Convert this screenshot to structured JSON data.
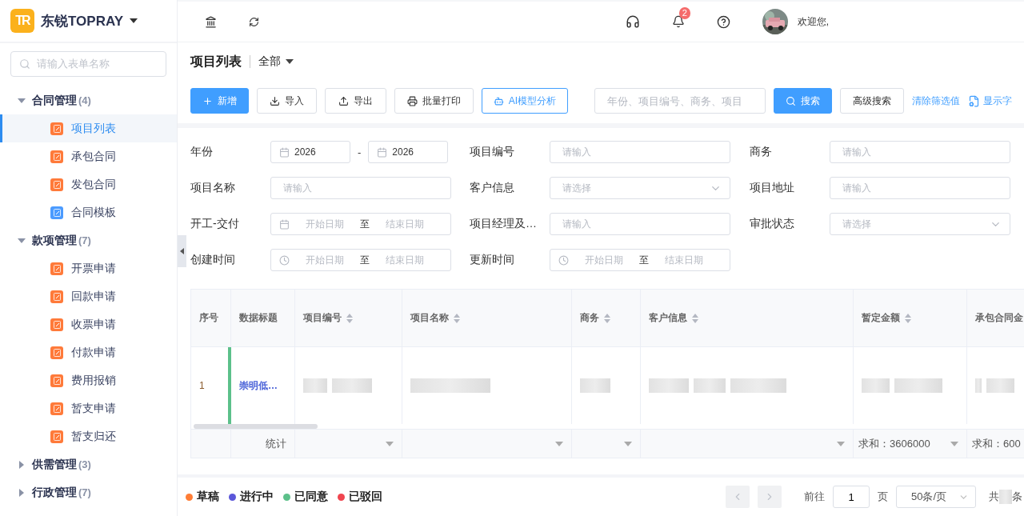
{
  "brand": {
    "name": "东锐TOPRAY",
    "logo": "TR"
  },
  "sidebar": {
    "search": {
      "placeholder": "请输入表单名称"
    },
    "groups": [
      {
        "label": "合同管理",
        "count": "(4)",
        "expanded": true,
        "children": [
          {
            "label": "项目列表",
            "selected": true,
            "color": "#ff7a3a"
          },
          {
            "label": "承包合同",
            "selected": false,
            "color": "#ff7a3a"
          },
          {
            "label": "发包合同",
            "selected": false,
            "color": "#ff7a3a"
          },
          {
            "label": "合同模板",
            "selected": false,
            "color": "#4b9bff"
          }
        ]
      },
      {
        "label": "款项管理",
        "count": "(7)",
        "expanded": true,
        "children": [
          {
            "label": "开票申请",
            "selected": false,
            "color": "#ff7a3a"
          },
          {
            "label": "回款申请",
            "selected": false,
            "color": "#ff7a3a"
          },
          {
            "label": "收票申请",
            "selected": false,
            "color": "#ff7a3a"
          },
          {
            "label": "付款申请",
            "selected": false,
            "color": "#ff7a3a"
          },
          {
            "label": "费用报销",
            "selected": false,
            "color": "#ff7a3a"
          },
          {
            "label": "暂支申请",
            "selected": false,
            "color": "#ff7a3a"
          },
          {
            "label": "暂支归还",
            "selected": false,
            "color": "#ff7a3a"
          }
        ]
      },
      {
        "label": "供需管理",
        "count": "(3)",
        "expanded": false
      },
      {
        "label": "行政管理",
        "count": "(7)",
        "expanded": false
      }
    ]
  },
  "topbar": {
    "notifications": "2",
    "greeting": "欢迎您,"
  },
  "page": {
    "title": "项目列表",
    "scope": "全部"
  },
  "toolbar": {
    "buttons": [
      {
        "label": "新增",
        "kind": "primary"
      },
      {
        "label": "导入",
        "kind": "default"
      },
      {
        "label": "导出",
        "kind": "default"
      },
      {
        "label": "批量打印",
        "kind": "default"
      },
      {
        "label": "AI模型分析",
        "kind": "outline"
      }
    ],
    "search": {
      "placeholder": "年份、项目编号、商务、项目"
    },
    "search_button": "搜索",
    "advanced": "高级搜索",
    "clear": "清除筛选值",
    "fields_link": "显示字"
  },
  "filters": [
    {
      "label": "年份",
      "kind": "year-range",
      "from": "2026",
      "separator": "-",
      "to": "2026"
    },
    {
      "label": "项目编号",
      "kind": "text",
      "placeholder": "请输入"
    },
    {
      "label": "商务",
      "kind": "text",
      "placeholder": "请输入"
    },
    {
      "label": "项目名称",
      "kind": "text",
      "placeholder": "请输入"
    },
    {
      "label": "客户信息",
      "kind": "select",
      "placeholder": "请选择"
    },
    {
      "label": "项目地址",
      "kind": "text",
      "placeholder": "请输入"
    },
    {
      "label": "开工-交付",
      "kind": "date-range",
      "start": "开始日期",
      "separator": "至",
      "end": "结束日期"
    },
    {
      "label": "项目经理及…",
      "kind": "text",
      "placeholder": "请输入"
    },
    {
      "label": "审批状态",
      "kind": "select",
      "placeholder": "请选择"
    },
    {
      "label": "创建时间",
      "kind": "time-range",
      "start": "开始日期",
      "separator": "至",
      "end": "结束日期"
    },
    {
      "label": "更新时间",
      "kind": "time-range",
      "start": "开始日期",
      "separator": "至",
      "end": "结束日期"
    }
  ],
  "table": {
    "columns": [
      {
        "label": "序号",
        "sortable": false
      },
      {
        "label": "数据标题",
        "sortable": false
      },
      {
        "label": "项目编号",
        "sortable": true
      },
      {
        "label": "项目名称",
        "sortable": true
      },
      {
        "label": "商务",
        "sortable": true
      },
      {
        "label": "客户信息",
        "sortable": true
      },
      {
        "label": "暂定金额",
        "sortable": true
      },
      {
        "label": "承包合同金",
        "sortable": false
      }
    ],
    "rows": [
      {
        "index": "1",
        "title": "崇明低…",
        "color": "#5cc08a"
      }
    ],
    "summary": {
      "label": "统计",
      "cells": [
        {
          "kind": "dropdown"
        },
        {
          "kind": "dropdown"
        },
        {
          "kind": "dropdown"
        },
        {
          "kind": "dropdown"
        },
        {
          "kind": "dropdown",
          "text": "求和：3606000"
        },
        {
          "kind": "text",
          "text": "求和：600"
        }
      ]
    }
  },
  "legend": [
    {
      "label": "草稿",
      "color": "#ff7d35"
    },
    {
      "label": "进行中",
      "color": "#5b57d9"
    },
    {
      "label": "已同意",
      "color": "#5cc08a"
    },
    {
      "label": "已驳回",
      "color": "#f0454f"
    }
  ],
  "pager": {
    "goto": "前往",
    "page": "1",
    "page_unit": "页",
    "size": "50条/页",
    "total_prefix": "共",
    "total_suffix": "条"
  }
}
